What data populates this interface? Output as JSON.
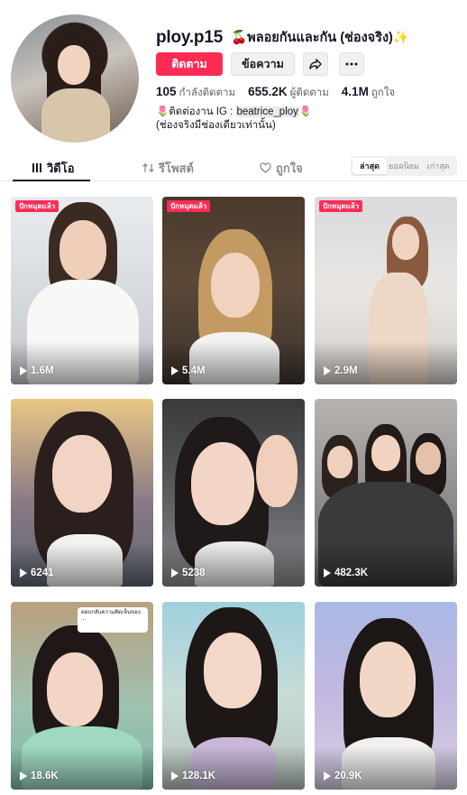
{
  "profile": {
    "username": "ploy.p15",
    "nickname": "🍒พลอยกันและกัน (ช่องจริง)✨",
    "follow_label": "ติดตาม",
    "message_label": "ข้อความ",
    "stats": [
      {
        "value": "105",
        "label": "กำลังติดตาม"
      },
      {
        "value": "655.2K",
        "label": "ผู้ติดตาม"
      },
      {
        "value": "4.1M",
        "label": "ถูกใจ"
      }
    ],
    "bio_line1_prefix": "🌷ติดต่องาน IG : ",
    "bio_line1_tag": "beatrice_ploy",
    "bio_line1_suffix": "🌷",
    "bio_line2": "(ช่องจริงมีช่องเดียวเท่านั้น)"
  },
  "tabs": [
    {
      "label": "วิดีโอ",
      "icon": "grid-lines-icon",
      "active": true
    },
    {
      "label": "รีโพสต์",
      "icon": "repost-icon",
      "active": false
    },
    {
      "label": "ถูกใจ",
      "icon": "heart-outline-icon",
      "active": false
    }
  ],
  "sort": {
    "options": [
      "ล่าสุด",
      "ยอดนิยม",
      "เก่าสุด"
    ],
    "selected": "ล่าสุด"
  },
  "videos": [
    {
      "views": "1.6M",
      "pinned": "ปักหมุดแล้ว"
    },
    {
      "views": "5.4M",
      "pinned": "ปักหมุดแล้ว"
    },
    {
      "views": "2.9M",
      "pinned": "ปักหมุดแล้ว"
    },
    {
      "views": "6241"
    },
    {
      "views": "5238"
    },
    {
      "views": "482.3K"
    },
    {
      "views": "18.6K",
      "comment_text": "ตอบกลับความคิดเห็นของ ..."
    },
    {
      "views": "128.1K"
    },
    {
      "views": "20.9K"
    }
  ],
  "colors": {
    "accent": "#fe2c55",
    "text": "#161823",
    "muted": "#8a8b91"
  }
}
